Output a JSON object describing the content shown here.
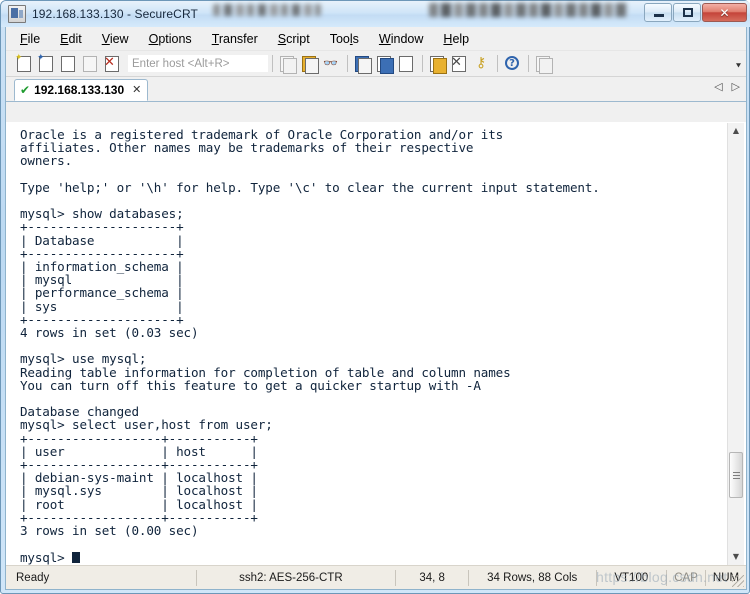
{
  "window": {
    "title": "192.168.133.130 - SecureCRT",
    "app_icon": "securecrt-icon",
    "minimize_label": "Minimize",
    "maximize_label": "Maximize",
    "close_label": "Close",
    "close_glyph": "✕"
  },
  "menu": {
    "items": [
      {
        "label": "File",
        "accel": "F"
      },
      {
        "label": "Edit",
        "accel": "E"
      },
      {
        "label": "View",
        "accel": "V"
      },
      {
        "label": "Options",
        "accel": "O"
      },
      {
        "label": "Transfer",
        "accel": "T"
      },
      {
        "label": "Script",
        "accel": "S"
      },
      {
        "label": "Tools",
        "accel": "l"
      },
      {
        "label": "Window",
        "accel": "W"
      },
      {
        "label": "Help",
        "accel": "H"
      }
    ]
  },
  "toolbar": {
    "host_placeholder": "Enter host <Alt+R>",
    "host_value": "",
    "overflow_glyph": "⯆",
    "icons": [
      "new-session-icon",
      "connect-icon",
      "connect-local-shell-icon",
      "reconnect-icon",
      "disconnect-icon",
      "copy-icon",
      "paste-icon",
      "find-icon",
      "print-screen-icon",
      "log-session-icon",
      "print-icon",
      "session-options-icon",
      "disconnect-all-icon",
      "key-icon",
      "help-icon",
      "arrange-icon"
    ]
  },
  "tabs": {
    "active_index": 0,
    "items": [
      {
        "label": "192.168.133.130",
        "status_icon": "connected-check-icon",
        "close_glyph": "✕"
      }
    ],
    "nav_prev_glyph": "◁",
    "nav_next_glyph": "▷"
  },
  "terminal": {
    "prompt": "mysql>",
    "cursor": "block",
    "lines": [
      "Oracle is a registered trademark of Oracle Corporation and/or its",
      "affiliates. Other names may be trademarks of their respective",
      "owners.",
      "",
      "Type 'help;' or '\\h' for help. Type '\\c' to clear the current input statement.",
      "",
      "mysql> show databases;",
      "+--------------------+",
      "| Database           |",
      "+--------------------+",
      "| information_schema |",
      "| mysql              |",
      "| performance_schema |",
      "| sys                |",
      "+--------------------+",
      "4 rows in set (0.03 sec)",
      "",
      "mysql> use mysql;",
      "Reading table information for completion of table and column names",
      "You can turn off this feature to get a quicker startup with -A",
      "",
      "Database changed",
      "mysql> select user,host from user;",
      "+------------------+-----------+",
      "| user             | host      |",
      "+------------------+-----------+",
      "| debian-sys-maint | localhost |",
      "| mysql.sys        | localhost |",
      "| root             | localhost |",
      "+------------------+-----------+",
      "3 rows in set (0.00 sec)",
      ""
    ],
    "last_line_prompt": "mysql> "
  },
  "scrollbar": {
    "up_glyph": "▲",
    "down_glyph": "▼",
    "thumb_position_percent": 86
  },
  "statusbar": {
    "state": "Ready",
    "cipher": "ssh2: AES-256-CTR",
    "cursor_position": "34,  8",
    "dimensions": "34 Rows, 88 Cols",
    "emulation": "VT100",
    "caps_lock": "CAP",
    "num_lock": "NUM"
  },
  "watermark": {
    "text": "https://blog.csdn.net"
  },
  "colors": {
    "terminal_fg": "#10243c",
    "terminal_bg": "#ffffff",
    "titlebar_accent": "#cfe4f7",
    "close_button": "#c4443a",
    "tab_check": "#1f9b2f",
    "statusbar_bg": "#f0ede6"
  }
}
